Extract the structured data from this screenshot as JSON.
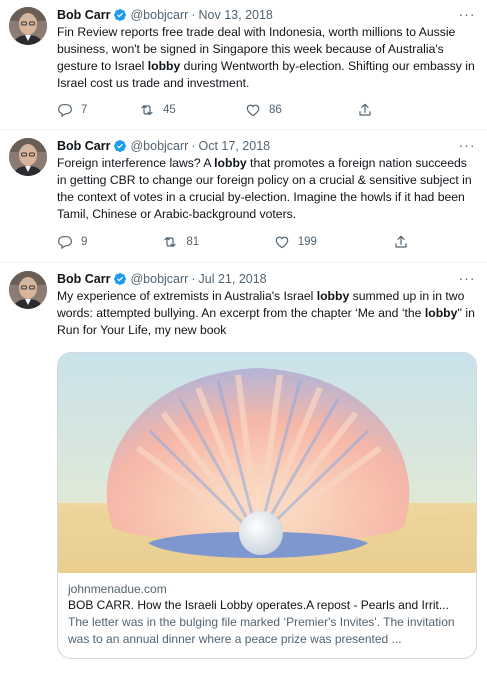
{
  "tweets": [
    {
      "name": "Bob Carr",
      "handle": "@bobjcarr",
      "dot": "·",
      "date": "Nov 13, 2018",
      "text_parts": [
        "Fin Review reports free trade deal with Indonesia, worth millions to Aussie business, won't be signed in Singapore this week because of Australia's gesture to Israel ",
        "lobby",
        " during Wentworth by-election. Shifting our embassy in Israel cost us trade and investment."
      ],
      "replies": "7",
      "retweets": "45",
      "likes": "86"
    },
    {
      "name": "Bob Carr",
      "handle": "@bobjcarr",
      "dot": "·",
      "date": "Oct 17, 2018",
      "text_parts": [
        "Foreign interference laws? A ",
        "lobby",
        " that promotes a foreign nation succeeds in getting CBR to change our foreign policy on a crucial & sensitive subject in the context of votes in a crucial by-election. Imagine the howls if it had been Tamil, Chinese or Arabic-background voters."
      ],
      "replies": "9",
      "retweets": "81",
      "likes": "199"
    },
    {
      "name": "Bob Carr",
      "handle": "@bobjcarr",
      "dot": "·",
      "date": "Jul 21, 2018",
      "text_parts": [
        "My experience of extremists in Australia's Israel ",
        "lobby",
        " summed up in in two words: attempted bullying. An excerpt from the chapter ‘Me and ‘the ",
        "lobby",
        "'' in Run for Your Life, my new book"
      ],
      "card": {
        "domain": "johnmenadue.com",
        "title": "BOB CARR. How the Israeli Lobby operates.A repost - Pearls and Irrit...",
        "description": "The letter was in the bulging file marked ‘Premier's Invites'. The invitation was to an annual dinner where a peace prize was presented ..."
      }
    }
  ],
  "icons": {
    "more": "more-horizontal-icon",
    "verified": "verified-badge-icon",
    "reply": "reply-icon",
    "retweet": "retweet-icon",
    "like": "heart-icon",
    "share": "share-icon"
  },
  "colors": {
    "verified": "#1d9bf0",
    "muted": "#536471",
    "text": "#0f1419",
    "border": "#cfd9de"
  }
}
